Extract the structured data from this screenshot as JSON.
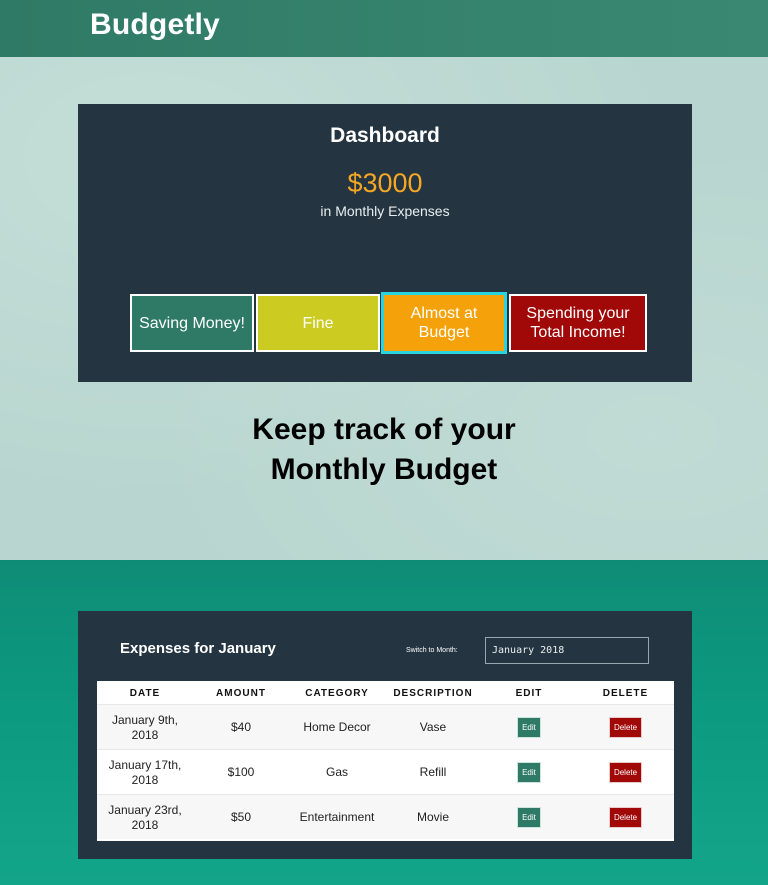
{
  "header": {
    "brand": "Budgetly"
  },
  "dashboard": {
    "title": "Dashboard",
    "amount": "$3000",
    "subtitle": "in Monthly Expenses",
    "statuses": [
      {
        "label": "Saving Money!",
        "color": "#2f7a66"
      },
      {
        "label": "Fine",
        "color": "#cccb22"
      },
      {
        "label": "Almost at Budget",
        "color": "#f5a20a",
        "selected": true
      },
      {
        "label": "Spending your Total Income!",
        "color": "#a10808"
      }
    ]
  },
  "tagline": {
    "line1": "Keep track of your",
    "line2": "Monthly Budget"
  },
  "expenses": {
    "title": "Expenses for January",
    "switch_label": "Switch to Month:",
    "month_value": "January 2018",
    "columns": [
      "DATE",
      "AMOUNT",
      "CATEGORY",
      "DESCRIPTION",
      "EDIT",
      "DELETE"
    ],
    "rows": [
      {
        "date": "January 9th, 2018",
        "amount": "$40",
        "category": "Home Decor",
        "description": "Vase",
        "edit": "Edit",
        "delete": "Delete"
      },
      {
        "date": "January 17th, 2018",
        "amount": "$100",
        "category": "Gas",
        "description": "Refill",
        "edit": "Edit",
        "delete": "Delete"
      },
      {
        "date": "January 23rd, 2018",
        "amount": "$50",
        "category": "Entertainment",
        "description": "Movie",
        "edit": "Edit",
        "delete": "Delete"
      }
    ]
  },
  "colors": {
    "brand": "#2f7a66",
    "accent": "#f5a623",
    "panel": "#243541",
    "danger": "#a10808"
  }
}
